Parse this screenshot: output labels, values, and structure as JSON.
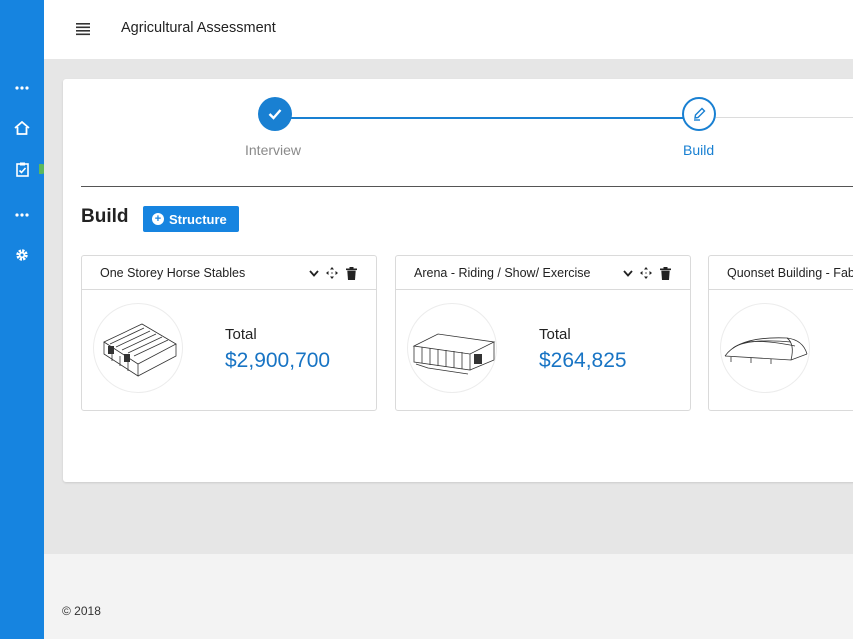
{
  "app": {
    "title": "Agricultural Assessment"
  },
  "sidebar": {
    "items": [
      {
        "icon": "more-dots-icon"
      },
      {
        "icon": "home-icon"
      },
      {
        "icon": "clipboard-check-icon"
      },
      {
        "icon": "more-dots-icon"
      },
      {
        "icon": "gear-icon"
      }
    ]
  },
  "stepper": {
    "steps": [
      {
        "label": "Interview",
        "status": "complete"
      },
      {
        "label": "Build",
        "status": "active"
      }
    ]
  },
  "build": {
    "title": "Build",
    "add_button_label": "Structure"
  },
  "structures": [
    {
      "name": "One Storey Horse Stables",
      "total_label": "Total",
      "total": "$2,900,700"
    },
    {
      "name": "Arena - Riding / Show/ Exercise",
      "total_label": "Total",
      "total": "$264,825"
    },
    {
      "name": "Quonset Building - Fabr",
      "total_label": "",
      "total": ""
    }
  ],
  "footer": {
    "copyright": "© 2018"
  },
  "colors": {
    "accent": "#1684e0",
    "value": "#1874c4",
    "status_dot": "#5cb85c"
  }
}
